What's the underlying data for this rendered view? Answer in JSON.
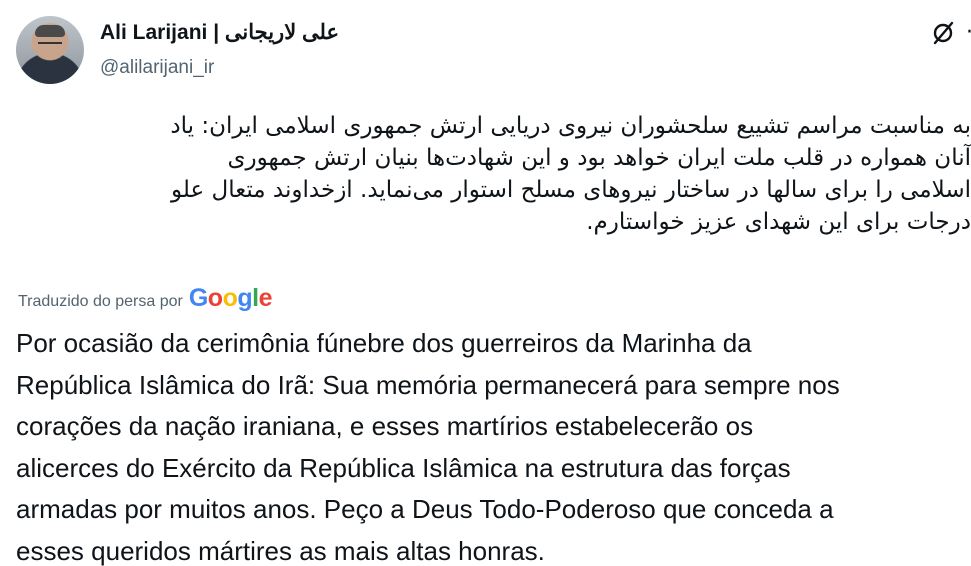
{
  "author": {
    "display_name": "Ali Larijani | علی لاریجانی",
    "handle": "@alilarijani_ir",
    "avatar_icon": "profile-photo"
  },
  "actions": {
    "grok_icon": "grok-slash-circle-icon",
    "more_icon": "more-dots-icon"
  },
  "persian_text": {
    "lines": [
      "به مناسبت مراسم تشییع سلحشوران نیروی دریایی ارتش جمهوری اسلامی ایران: یاد",
      "آنان همواره در قلب ملت ایران خواهد بود و این شهادت‌ها بنیان ارتش جمهوری",
      "اسلامی را برای سالها در ساختار نیروهای مسلح استوار می‌نماید. ازخداوند متعال علو",
      "درجات برای این شهدای عزیز خواستارم."
    ]
  },
  "translation": {
    "label": "Traduzido do persa por",
    "provider": "Google",
    "lines": [
      "Por ocasião da cerimônia fúnebre dos guerreiros da Marinha da",
      "República Islâmica do Irã: Sua memória permanecerá para sempre nos",
      "corações da nação iraniana, e esses martírios estabelecerão os",
      "alicerces do Exército da República Islâmica na estrutura das forças",
      "armadas por muitos anos. Peço a Deus Todo-Poderoso que conceda a",
      "esses queridos mártires as mais altas honras."
    ]
  },
  "colors": {
    "text_primary": "#0f1419",
    "text_secondary": "#536471",
    "google_blue": "#4285F4",
    "google_red": "#EA4335",
    "google_yellow": "#FBBC05",
    "google_green": "#34A853"
  }
}
